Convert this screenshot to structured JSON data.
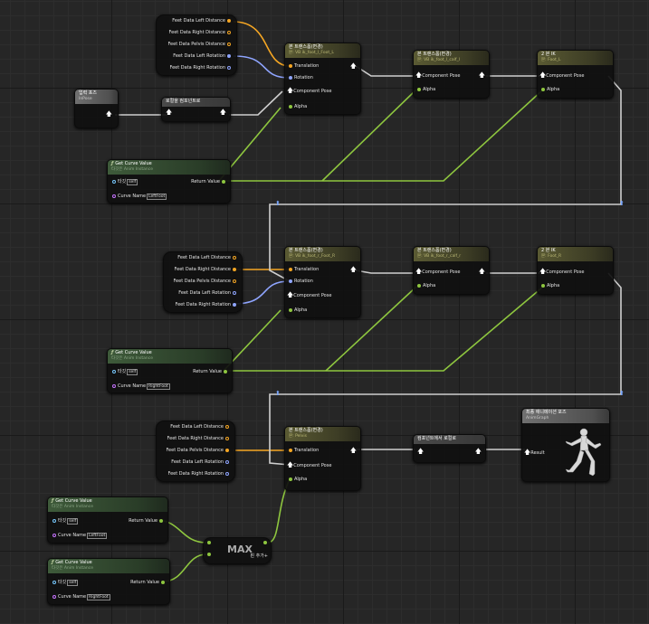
{
  "breaks": {
    "top": {
      "items": [
        "Feet Data Left Distance",
        "Feet Data Right Distance",
        "Feet Data Pelvis Distance",
        "Feet Data Left Rotation",
        "Feet Data Right Rotation"
      ]
    },
    "mid": {
      "items": [
        "Feet Data Left Distance",
        "Feet Data Right Distance",
        "Feet Data Pelvis Distance",
        "Feet Data Left Rotation",
        "Feet Data Right Rotation"
      ]
    },
    "bot": {
      "items": [
        "Feet Data Left Distance",
        "Feet Data Right Distance",
        "Feet Data Pelvis Distance",
        "Feet Data Left Rotation",
        "Feet Data Right Rotation"
      ]
    }
  },
  "input_pose": {
    "title": "입력 포즈",
    "subtitle": "InPose"
  },
  "to_component": {
    "title": "로컬을 컴포넌트로"
  },
  "from_component": {
    "title": "컴포넌트에서 로컬로"
  },
  "bone_xform": {
    "title": "본 트랜스폼(변경)",
    "translation": "Translation",
    "rotation": "Rotation",
    "component_pose": "Component Pose",
    "alpha": "Alpha",
    "n1_sub": "본: VB ik_foot_l_Foot_L",
    "n2_sub": "본: VB ik_foot_r_Foot_R",
    "n3_sub": "본: Pelvis"
  },
  "copy_xform": {
    "title": "본 트랜스폼(변경)",
    "n1_sub": "본: VB ik_foot_l_calf_l",
    "n2_sub": "본: VB ik_foot_r_calf_r",
    "component_pose": "Component Pose",
    "alpha": "Alpha"
  },
  "twobone": {
    "title": "2 본 IK",
    "n1_sub": "본: Foot_L",
    "n2_sub": "본: Foot_R",
    "component_pose": "Component Pose",
    "alpha": "Alpha"
  },
  "curve": {
    "title": "Get Curve Value",
    "subtitle": "타깃은 Anim Instance",
    "target": "타깃",
    "self": "self",
    "curve_name": "Curve Name",
    "return_value": "Return Value",
    "left": "LeftFoot",
    "right": "RightFoot"
  },
  "max_node": {
    "title": "MAX",
    "add_pin": "핀 추가"
  },
  "result": {
    "title": "최종 애니메이션 포즈",
    "subtitle": "AnimGraph",
    "pin": "Result"
  },
  "colors": {
    "exec_green": "#8ec63f",
    "struct_orange": "#f5a623",
    "rotator_blue": "#8fa5ff",
    "pose_white": "#ffffff"
  }
}
